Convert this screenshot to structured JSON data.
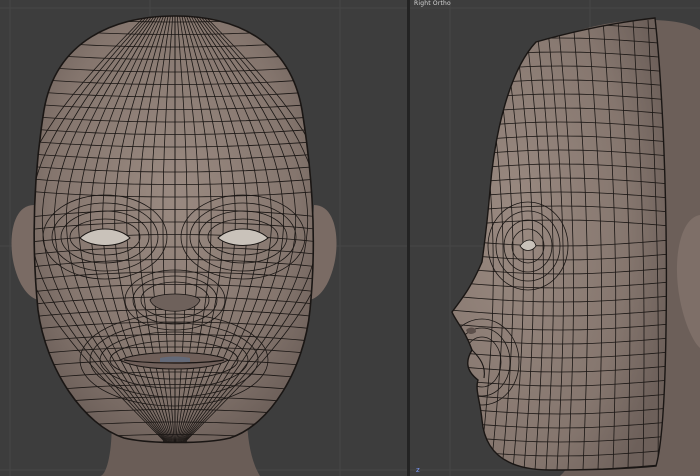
{
  "viewports": {
    "front": {
      "view": "front",
      "mode": "edit"
    },
    "side": {
      "view": "right",
      "mode": "edit",
      "label": "Right Ortho",
      "axis_label": "z"
    }
  },
  "colors": {
    "background": "#3d3d3d",
    "grid": "#474747",
    "skin": "#8a7a72",
    "wire": "#1a1614",
    "divider": "#232323"
  },
  "mesh": {
    "type": "head-topology-wireframe"
  }
}
